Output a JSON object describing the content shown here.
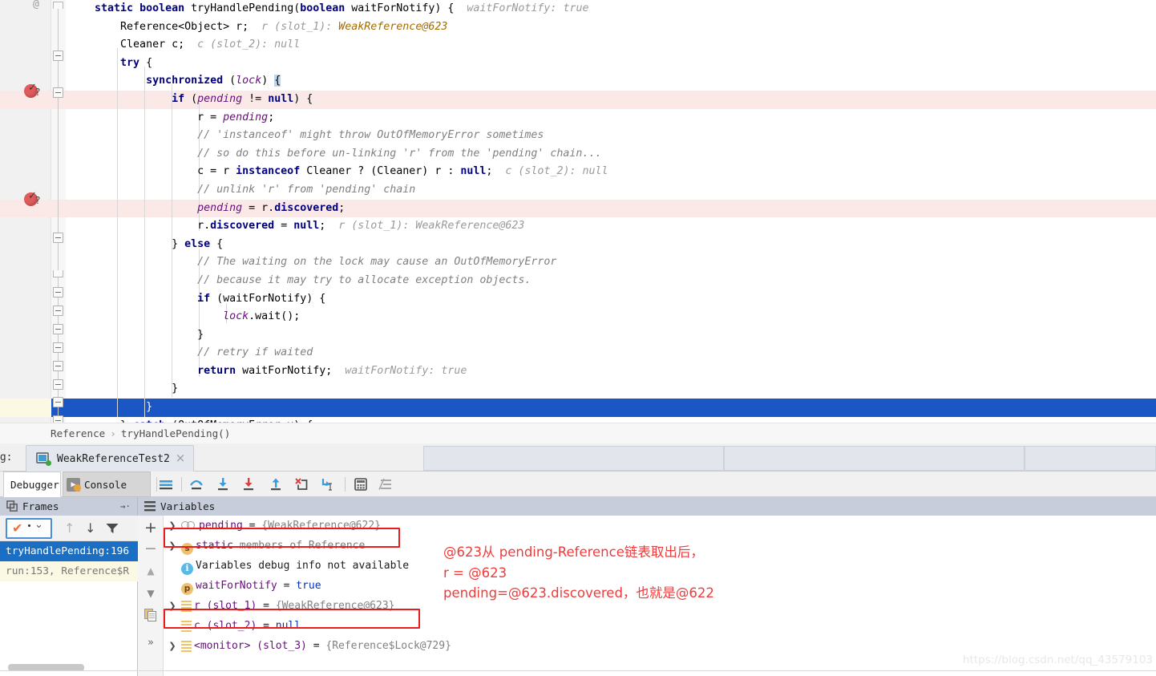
{
  "editor": {
    "at_marker": "@",
    "lines": [
      {
        "state": "normal",
        "segments": [
          {
            "t": "    ",
            "c": ""
          },
          {
            "t": "static boolean ",
            "c": "kw"
          },
          {
            "t": "tryHandlePending(",
            "c": ""
          },
          {
            "t": "boolean ",
            "c": "kw"
          },
          {
            "t": "waitForNotify) { ",
            "c": ""
          },
          {
            "t": " waitForNotify: true",
            "c": "hint"
          }
        ]
      },
      {
        "state": "normal",
        "segments": [
          {
            "t": "        Reference<Object> r;  ",
            "c": ""
          },
          {
            "t": "r (slot_1): ",
            "c": "hint"
          },
          {
            "t": "WeakReference@623",
            "c": "hintv"
          }
        ]
      },
      {
        "state": "normal",
        "segments": [
          {
            "t": "        Cleaner c;  ",
            "c": ""
          },
          {
            "t": "c (slot_2): null",
            "c": "hint"
          }
        ]
      },
      {
        "state": "normal",
        "segments": [
          {
            "t": "        ",
            "c": ""
          },
          {
            "t": "try",
            "c": "kw"
          },
          {
            "t": " {",
            "c": ""
          }
        ]
      },
      {
        "state": "normal",
        "segments": [
          {
            "t": "            ",
            "c": ""
          },
          {
            "t": "synchronized",
            "c": "kw"
          },
          {
            "t": " (",
            "c": ""
          },
          {
            "t": "lock",
            "c": "fld"
          },
          {
            "t": ") ",
            "c": ""
          },
          {
            "t": "{",
            "c": "caretbox"
          }
        ]
      },
      {
        "state": "bp",
        "segments": [
          {
            "t": "                ",
            "c": ""
          },
          {
            "t": "if",
            "c": "kw"
          },
          {
            "t": " (",
            "c": ""
          },
          {
            "t": "pending",
            "c": "fld"
          },
          {
            "t": " != ",
            "c": ""
          },
          {
            "t": "null",
            "c": "kw"
          },
          {
            "t": ") {",
            "c": ""
          }
        ]
      },
      {
        "state": "normal",
        "segments": [
          {
            "t": "                    r = ",
            "c": ""
          },
          {
            "t": "pending",
            "c": "fld"
          },
          {
            "t": ";",
            "c": ""
          }
        ]
      },
      {
        "state": "normal",
        "segments": [
          {
            "t": "                    // 'instanceof' might throw OutOfMemoryError sometimes",
            "c": "cmt"
          }
        ]
      },
      {
        "state": "normal",
        "segments": [
          {
            "t": "                    // so do this before un-linking 'r' from the 'pending' chain...",
            "c": "cmt"
          }
        ]
      },
      {
        "state": "normal",
        "segments": [
          {
            "t": "                    c = r ",
            "c": ""
          },
          {
            "t": "instanceof",
            "c": "kw"
          },
          {
            "t": " Cleaner ? (Cleaner) r : ",
            "c": ""
          },
          {
            "t": "null",
            "c": "kw"
          },
          {
            "t": ";  ",
            "c": ""
          },
          {
            "t": "c (slot_2): null",
            "c": "hint"
          }
        ]
      },
      {
        "state": "normal",
        "segments": [
          {
            "t": "                    // unlink 'r' from 'pending' chain",
            "c": "cmt"
          }
        ]
      },
      {
        "state": "bp",
        "segments": [
          {
            "t": "                    ",
            "c": ""
          },
          {
            "t": "pending",
            "c": "fld"
          },
          {
            "t": " = r.",
            "c": ""
          },
          {
            "t": "discovered",
            "c": "kwb"
          },
          {
            "t": ";",
            "c": ""
          }
        ]
      },
      {
        "state": "normal",
        "segments": [
          {
            "t": "                    r.",
            "c": ""
          },
          {
            "t": "discovered",
            "c": "kwb"
          },
          {
            "t": " = ",
            "c": ""
          },
          {
            "t": "null",
            "c": "kw"
          },
          {
            "t": ";  ",
            "c": ""
          },
          {
            "t": "r (slot_1): WeakReference@623",
            "c": "hint"
          }
        ]
      },
      {
        "state": "normal",
        "segments": [
          {
            "t": "                } ",
            "c": ""
          },
          {
            "t": "else",
            "c": "kw"
          },
          {
            "t": " {",
            "c": ""
          }
        ]
      },
      {
        "state": "normal",
        "segments": [
          {
            "t": "                    // The waiting on the lock may cause an OutOfMemoryError",
            "c": "cmt"
          }
        ]
      },
      {
        "state": "normal",
        "segments": [
          {
            "t": "                    // because it may try to allocate exception objects.",
            "c": "cmt"
          }
        ]
      },
      {
        "state": "normal",
        "segments": [
          {
            "t": "                    ",
            "c": ""
          },
          {
            "t": "if",
            "c": "kw"
          },
          {
            "t": " (waitForNotify) {",
            "c": ""
          }
        ]
      },
      {
        "state": "normal",
        "segments": [
          {
            "t": "                        ",
            "c": ""
          },
          {
            "t": "lock",
            "c": "fld"
          },
          {
            "t": ".wait();",
            "c": ""
          }
        ]
      },
      {
        "state": "normal",
        "segments": [
          {
            "t": "                    }",
            "c": ""
          }
        ]
      },
      {
        "state": "normal",
        "segments": [
          {
            "t": "                    // retry if waited",
            "c": "cmt"
          }
        ]
      },
      {
        "state": "normal",
        "segments": [
          {
            "t": "                    ",
            "c": ""
          },
          {
            "t": "return",
            "c": "kw"
          },
          {
            "t": " waitForNotify;  ",
            "c": ""
          },
          {
            "t": "waitForNotify: true",
            "c": "hint"
          }
        ]
      },
      {
        "state": "normal",
        "segments": [
          {
            "t": "                }",
            "c": ""
          }
        ]
      },
      {
        "state": "exec",
        "segments": [
          {
            "t": "            }",
            "c": ""
          }
        ]
      },
      {
        "state": "normal",
        "segments": [
          {
            "t": "        } ",
            "c": ""
          },
          {
            "t": "catch",
            "c": "kw"
          },
          {
            "t": " (OutOfMemoryError x) {",
            "c": ""
          }
        ]
      }
    ]
  },
  "breadcrumb": {
    "class_name": "Reference",
    "separator": "›",
    "method_name": "tryHandlePending()"
  },
  "debug_window": {
    "label": "ug:",
    "run_tab": {
      "title": "WeakReferenceTest2",
      "close": "×"
    },
    "subtabs": [
      {
        "label": "Debugger",
        "active": true
      },
      {
        "label": "Console →·",
        "active": false
      }
    ],
    "toolbar_icons": [
      "show-execution-point-icon",
      "step-over-icon",
      "step-into-icon",
      "force-step-into-icon",
      "step-out-icon",
      "drop-frame-icon",
      "run-to-cursor-icon",
      "evaluate-expression-icon",
      "mute-breakpoints-icon"
    ],
    "frames_pane": {
      "title": "Frames",
      "settings_glyph": "→·",
      "thread_combo_label": "thread-selector",
      "buttons": [
        "up-arrow",
        "down-arrow",
        "filter-funnel"
      ],
      "frames": [
        {
          "label": "tryHandlePending:196",
          "selected": true
        },
        {
          "label": "run:153, Reference$R",
          "selected": false
        }
      ]
    },
    "vars_side_buttons": [
      "+",
      "−",
      "▲",
      "▼",
      "copy",
      "»"
    ],
    "variables_pane": {
      "title": "Variables",
      "rows": [
        {
          "twisty": "❯",
          "icon": "static-field-icon",
          "name": "pending",
          "eq": " = ",
          "value": "{WeakReference@622}",
          "value_style": "ref",
          "highlight": true
        },
        {
          "twisty": "❯",
          "icon": "static-members-icon",
          "name": "static",
          "eq": " ",
          "value": "members of Reference",
          "value_style": "gray",
          "highlight": false
        },
        {
          "twisty": "",
          "icon": "info-icon",
          "name": "Variables debug info not available",
          "eq": "",
          "value": "",
          "value_style": "plain",
          "highlight": false
        },
        {
          "twisty": "",
          "icon": "parameter-icon",
          "name": "waitForNotify",
          "eq": " = ",
          "value": "true",
          "value_style": "kw",
          "highlight": false
        },
        {
          "twisty": "❯",
          "icon": "slot-icon",
          "name": "r (slot_1)",
          "eq": " = ",
          "value": "{WeakReference@623}",
          "value_style": "ref",
          "highlight": true
        },
        {
          "twisty": "",
          "icon": "slot-icon",
          "name": "c (slot_2)",
          "eq": " = ",
          "value": "null",
          "value_style": "kw",
          "highlight": false
        },
        {
          "twisty": "❯",
          "icon": "slot-icon",
          "name": "<monitor> (slot_3)",
          "eq": " = ",
          "value": "{Reference$Lock@729}",
          "value_style": "ref",
          "highlight": false
        }
      ]
    }
  },
  "annotation": {
    "text": "@623从 pending-Reference链表取出后，\nr = @623\npending=@623.discovered，也就是@622",
    "color": "#ef3b3b"
  },
  "watermark": {
    "text": "https://blog.csdn.net/qq_43579103"
  },
  "colors": {
    "breakpoint_line": "#fbe9e7",
    "execution_line": "#1a56c4",
    "selection": "#c8dcf5",
    "keyword": "#000080",
    "field": "#660e7a",
    "comment": "#808080",
    "frames_selected": "#1a6fc4",
    "pane_header": "#c7cdda",
    "highlight_box": "#e81d1d"
  }
}
